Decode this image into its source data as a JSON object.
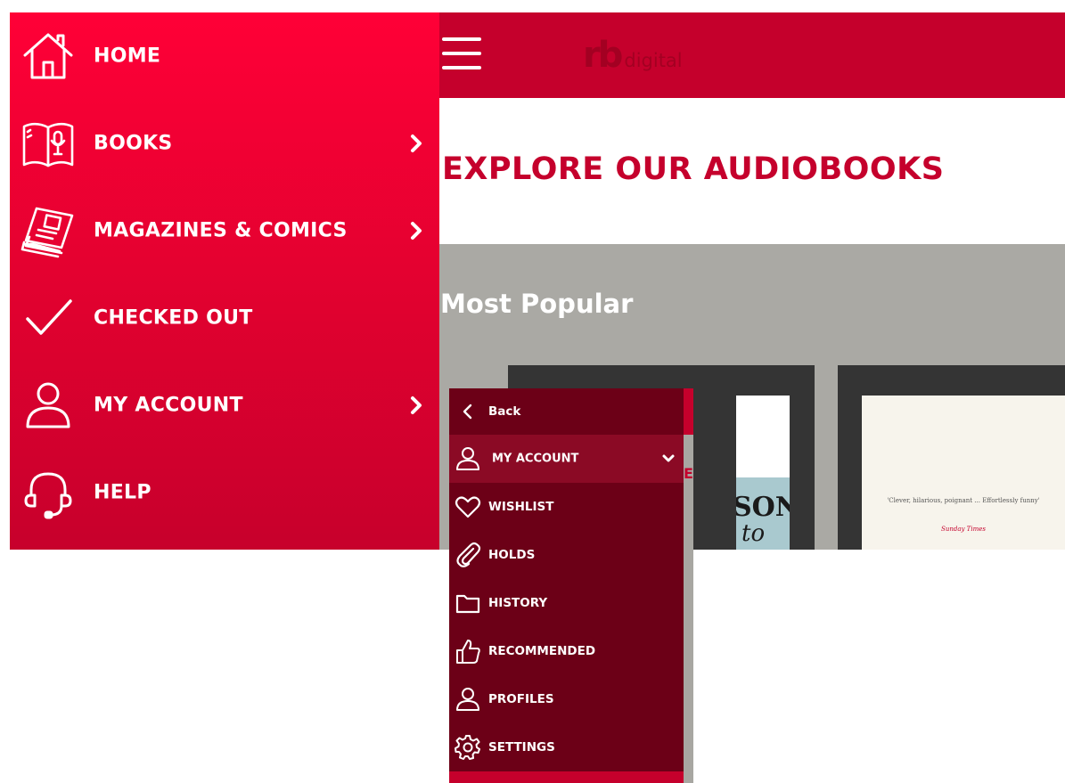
{
  "header": {
    "logo_mark": "rb",
    "logo_word": "digital"
  },
  "page": {
    "title": "EXPLORE OUR AUDIOBOOKS",
    "section_title": "Most Popular",
    "book1_cover_text": "SON",
    "book1_cover_script": "to",
    "book2_quote": "'Clever, hilarious, poignant ... Effortlessly funny'",
    "book2_quote_source": "Sunday Times"
  },
  "main_nav": {
    "items": [
      {
        "label": "HOME",
        "icon": "home-icon"
      },
      {
        "label": "BOOKS",
        "icon": "book-icon"
      },
      {
        "label": "MAGAZINES & COMICS",
        "icon": "magazine-icon"
      },
      {
        "label": "CHECKED OUT",
        "icon": "checkmark-icon"
      },
      {
        "label": "MY ACCOUNT",
        "icon": "user-icon"
      },
      {
        "label": "HELP",
        "icon": "headset-icon"
      }
    ]
  },
  "account_menu": {
    "back_label": "Back",
    "header_label": "MY ACCOUNT",
    "items": [
      {
        "label": "WISHLIST",
        "icon": "heart-icon"
      },
      {
        "label": "HOLDS",
        "icon": "paperclip-icon"
      },
      {
        "label": "HISTORY",
        "icon": "folder-icon"
      },
      {
        "label": "RECOMMENDED",
        "icon": "thumbs-up-icon"
      },
      {
        "label": "PROFILES",
        "icon": "user-icon"
      },
      {
        "label": "SETTINGS",
        "icon": "gear-icon"
      }
    ]
  },
  "colors": {
    "brand_red": "#c5002c",
    "nav_red": "#ff0037",
    "submenu_dark": "#6c0017",
    "submenu_active": "#8b0a25",
    "page_gray": "#aaa9a4"
  }
}
